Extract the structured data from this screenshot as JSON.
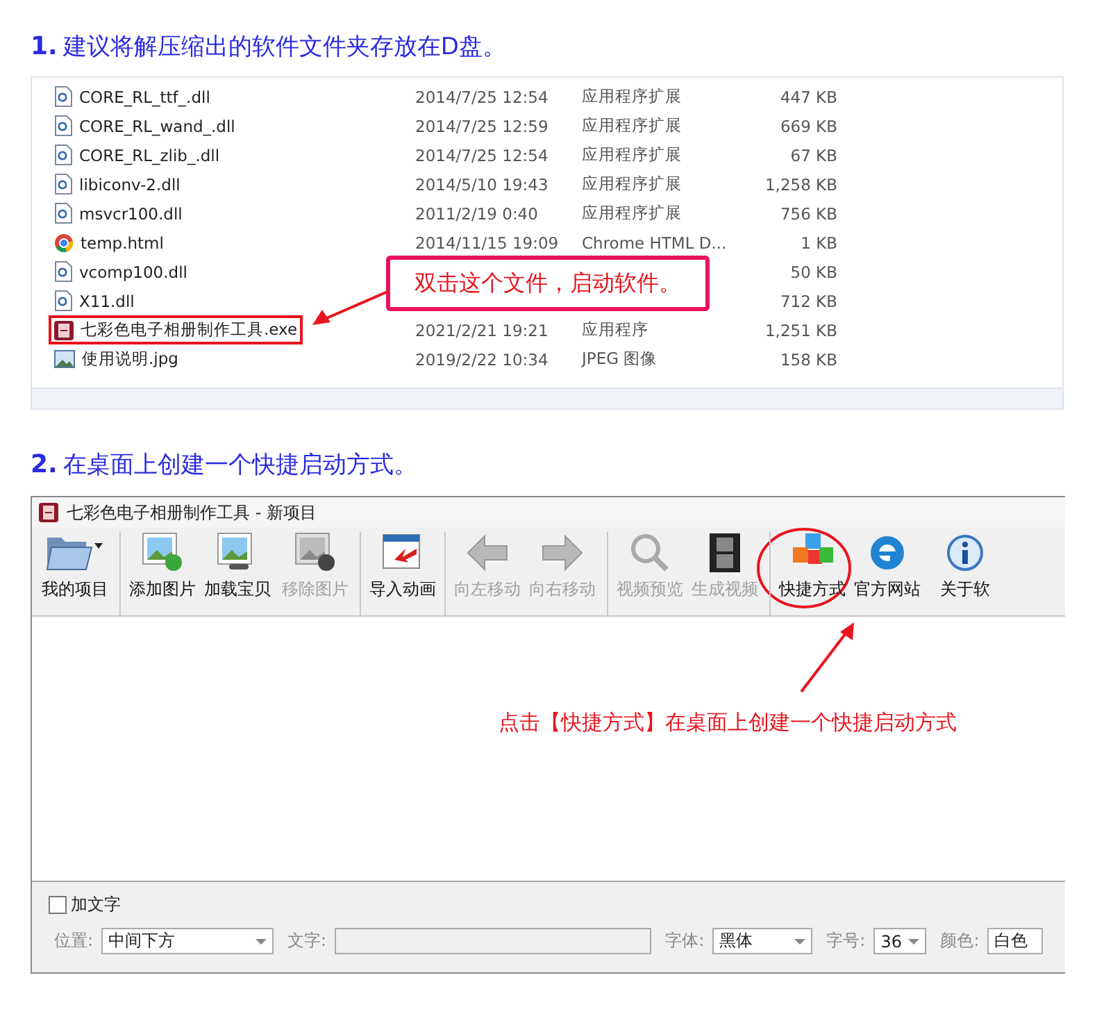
{
  "step1": {
    "number": "1.",
    "text": "建议将解压缩出的软件文件夹存放在D盘。"
  },
  "files": [
    {
      "kind": "dll",
      "name": "CORE_RL_ttf_.dll",
      "date": "2014/7/25 12:54",
      "type": "应用程序扩展",
      "size": "447 KB",
      "highlighted": false
    },
    {
      "kind": "dll",
      "name": "CORE_RL_wand_.dll",
      "date": "2014/7/25 12:59",
      "type": "应用程序扩展",
      "size": "669 KB",
      "highlighted": false
    },
    {
      "kind": "dll",
      "name": "CORE_RL_zlib_.dll",
      "date": "2014/7/25 12:54",
      "type": "应用程序扩展",
      "size": "67 KB",
      "highlighted": false
    },
    {
      "kind": "dll",
      "name": "libiconv-2.dll",
      "date": "2014/5/10 19:43",
      "type": "应用程序扩展",
      "size": "1,258 KB",
      "highlighted": false
    },
    {
      "kind": "dll",
      "name": "msvcr100.dll",
      "date": "2011/2/19 0:40",
      "type": "应用程序扩展",
      "size": "756 KB",
      "highlighted": false
    },
    {
      "kind": "browser",
      "name": "temp.html",
      "date": "2014/11/15 19:09",
      "type": "Chrome HTML D...",
      "size": "1 KB",
      "highlighted": false
    },
    {
      "kind": "dll",
      "name": "vcomp100.dll",
      "size": "50 KB",
      "highlighted": false
    },
    {
      "kind": "dll",
      "name": "X11.dll",
      "size": "712 KB",
      "highlighted": false
    },
    {
      "kind": "exe",
      "name": "七彩色电子相册制作工具.exe",
      "date": "2021/2/21 19:21",
      "type": "应用程序",
      "size": "1,251 KB",
      "highlighted": true
    },
    {
      "kind": "image",
      "name": "使用说明.jpg",
      "date": "2019/2/22 10:34",
      "type": "JPEG 图像",
      "size": "158 KB",
      "highlighted": false
    }
  ],
  "callout1": "双击这个文件，启动软件。",
  "step2": {
    "number": "2.",
    "text": "在桌面上创建一个快捷启动方式。"
  },
  "window": {
    "title": "七彩色电子相册制作工具 - 新项目"
  },
  "toolbar": [
    {
      "kind": "folder",
      "label": "我的项目",
      "disabled": false,
      "highlighted": false,
      "separator_before": false
    },
    {
      "kind": "add",
      "label": "添加图片",
      "disabled": false,
      "highlighted": false,
      "separator_before": true
    },
    {
      "kind": "link",
      "label": "加载宝贝",
      "disabled": false,
      "highlighted": false,
      "separator_before": false
    },
    {
      "kind": "remove",
      "label": "移除图片",
      "disabled": true,
      "highlighted": false,
      "separator_before": false
    },
    {
      "kind": "import",
      "label": "导入动画",
      "disabled": false,
      "highlighted": false,
      "separator_before": true
    },
    {
      "kind": "left",
      "label": "向左移动",
      "disabled": true,
      "highlighted": false,
      "separator_before": true
    },
    {
      "kind": "right",
      "label": "向右移动",
      "disabled": true,
      "highlighted": false,
      "separator_before": false
    },
    {
      "kind": "zoom",
      "label": "视频预览",
      "disabled": true,
      "highlighted": false,
      "separator_before": true
    },
    {
      "kind": "film",
      "label": "生成视频",
      "disabled": true,
      "highlighted": false,
      "separator_before": false
    },
    {
      "kind": "cubes",
      "label": "快捷方式",
      "disabled": false,
      "highlighted": true,
      "separator_before": true
    },
    {
      "kind": "globe",
      "label": "官方网站",
      "disabled": false,
      "highlighted": false,
      "separator_before": false
    },
    {
      "kind": "info",
      "label": "关于软",
      "disabled": false,
      "highlighted": false,
      "separator_before": false
    }
  ],
  "callout2": "点击【快捷方式】在桌面上创建一个快捷启动方式",
  "text_panel": {
    "checkbox": {
      "label": "加文字",
      "checked": false
    },
    "position": {
      "label": "位置:",
      "value": "中间下方"
    },
    "text": {
      "label": "文字:"
    },
    "font": {
      "label": "字体:",
      "value": "黑体"
    },
    "size": {
      "label": "字号:",
      "value": "36"
    },
    "color": {
      "label": "颜色:",
      "value": "白色"
    }
  }
}
